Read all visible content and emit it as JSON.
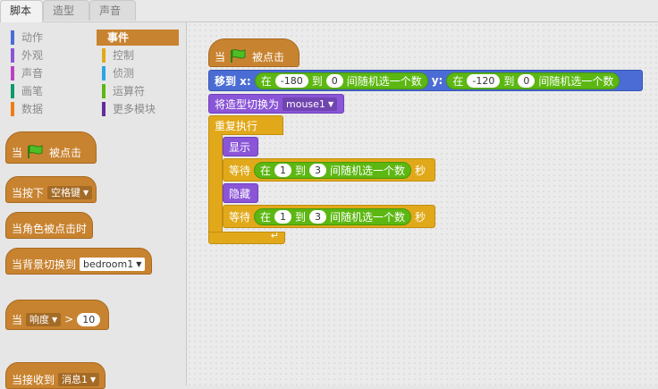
{
  "tabs": [
    "脚本",
    "造型",
    "声音"
  ],
  "categories": [
    {
      "label": "动作",
      "color": "#4a6cd4"
    },
    {
      "label": "事件",
      "color": "#c88330"
    },
    {
      "label": "外观",
      "color": "#8a55d7"
    },
    {
      "label": "控制",
      "color": "#e1a91a"
    },
    {
      "label": "声音",
      "color": "#bb42c3"
    },
    {
      "label": "侦测",
      "color": "#2ca5e2"
    },
    {
      "label": "画笔",
      "color": "#0e9a6c"
    },
    {
      "label": "运算符",
      "color": "#5cb712"
    },
    {
      "label": "数据",
      "color": "#ee7d16"
    },
    {
      "label": "更多模块",
      "color": "#632d99"
    }
  ],
  "palette": {
    "when_flag_when": "当",
    "when_flag_clicked": "被点击",
    "key_pressed": "当按下",
    "key_value": "空格键",
    "sprite_clicked": "当角色被点击时",
    "backdrop_switch": "当背景切换到",
    "backdrop_value": "bedroom1",
    "when_label": "当",
    "sensor_value": "响度",
    "gt": ">",
    "sensor_num": "10",
    "receive_label": "当接收到",
    "message_value": "消息1"
  },
  "script": {
    "hat_when": "当",
    "hat_clicked": "被点击",
    "move_label": "移到 x:",
    "in_1": "在",
    "x_from": "-180",
    "to_1": "到",
    "x_to": "0",
    "rand_1": "间随机选一个数",
    "y_label": "y:",
    "in_2": "在",
    "y_from": "-120",
    "to_2": "到",
    "y_to": "0",
    "rand_2": "间随机选一个数",
    "costume_label": "将造型切换为",
    "costume_value": "mouse1",
    "forever": "重复执行",
    "show": "显示",
    "wait_1": "等待",
    "in_3": "在",
    "w1_from": "1",
    "to_3": "到",
    "w1_to": "3",
    "rand_3": "间随机选一个数",
    "sec_1": "秒",
    "hide": "隐藏",
    "wait_2": "等待",
    "in_4": "在",
    "w2_from": "1",
    "to_4": "到",
    "w2_to": "3",
    "rand_4": "间随机选一个数",
    "sec_2": "秒"
  }
}
